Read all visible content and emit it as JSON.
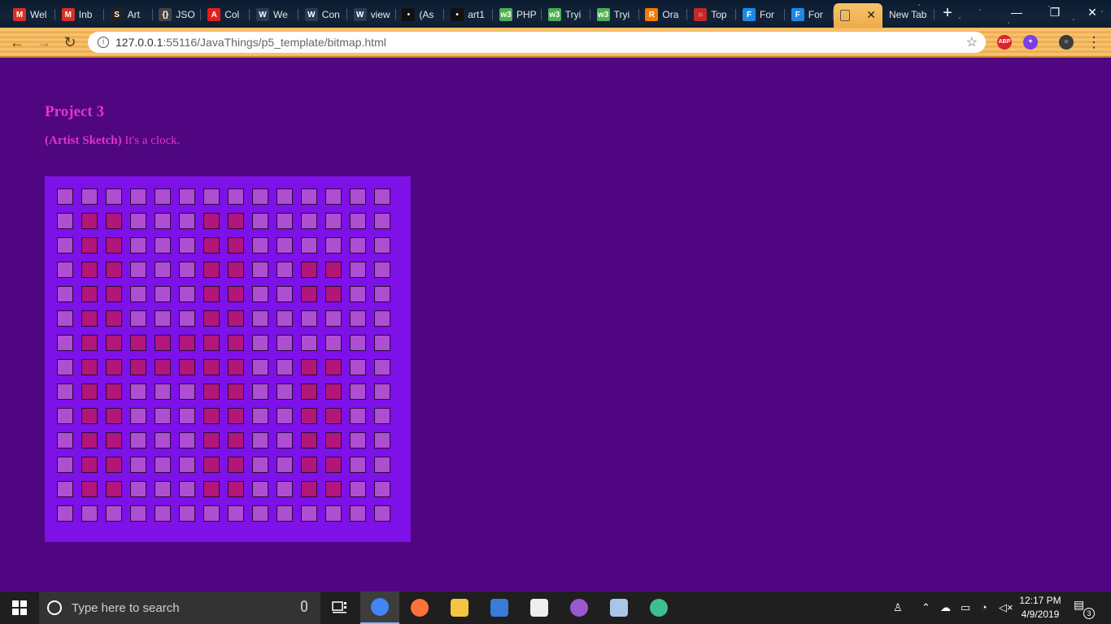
{
  "browser": {
    "tabs": [
      {
        "title": "Wel",
        "icon": "gmail-icon",
        "color": "#d93025",
        "glyph": "M"
      },
      {
        "title": "Inb",
        "icon": "gmail-icon",
        "color": "#d93025",
        "glyph": "M"
      },
      {
        "title": "Art",
        "icon": "s-icon",
        "color": "#222222",
        "glyph": "S"
      },
      {
        "title": "JSO",
        "icon": "braces-icon",
        "color": "#444444",
        "glyph": "{}"
      },
      {
        "title": "Col",
        "icon": "adobe-icon",
        "color": "#e0211b",
        "glyph": "A"
      },
      {
        "title": "We",
        "icon": "wix-icon",
        "color": "#2b3a55",
        "glyph": "W"
      },
      {
        "title": "Con",
        "icon": "wix-icon",
        "color": "#2b3a55",
        "glyph": "W"
      },
      {
        "title": "view",
        "icon": "wix-icon",
        "color": "#2b3a55",
        "glyph": "W"
      },
      {
        "title": "(As",
        "icon": "face-icon",
        "color": "#111111",
        "glyph": "•"
      },
      {
        "title": "art1",
        "icon": "face-icon",
        "color": "#111111",
        "glyph": "•"
      },
      {
        "title": "PHP",
        "icon": "w3-icon",
        "color": "#4caf50",
        "glyph": "w3"
      },
      {
        "title": "Tryi",
        "icon": "w3-icon",
        "color": "#4caf50",
        "glyph": "w3"
      },
      {
        "title": "Tryi",
        "icon": "w3-icon",
        "color": "#4caf50",
        "glyph": "w3"
      },
      {
        "title": "Ora",
        "icon": "r-icon",
        "color": "#f57c00",
        "glyph": "R"
      },
      {
        "title": "Top",
        "icon": "spinner-icon",
        "color": "#c62828",
        "glyph": "○"
      },
      {
        "title": "For",
        "icon": "form-icon",
        "color": "#1e88e5",
        "glyph": "F"
      },
      {
        "title": "For",
        "icon": "form-icon",
        "color": "#1e88e5",
        "glyph": "F"
      }
    ],
    "active_tab": {
      "title": "",
      "icon": "page-icon",
      "close_glyph": "✕"
    },
    "new_tab": {
      "title": "New Tab"
    },
    "new_tab_button": "+",
    "window_controls": {
      "minimize": "—",
      "restore": "❐",
      "close": "✕"
    },
    "nav": {
      "back": "←",
      "forward": "→",
      "reload": "↻"
    },
    "address": {
      "host": "127.0.0.1",
      "rest": ":55116/JavaThings/p5_template/bitmap.html",
      "info_glyph": "i",
      "star_glyph": "☆"
    },
    "extensions": [
      {
        "name": "abp-icon",
        "label": "ABP",
        "color": "#d8262c"
      },
      {
        "name": "color-picker-icon",
        "label": "✦",
        "color": "#7b3fe4"
      },
      {
        "name": "profile-avatar-icon",
        "label": "☺",
        "color": "#3b3b3b"
      }
    ],
    "menu_glyph": "⋮"
  },
  "page": {
    "title": "Project 3",
    "subtitle_bold": "(Artist Sketch)",
    "subtitle_rest": " It's a clock.",
    "canvas": {
      "rows": 14,
      "cols": 14,
      "background": "#7e10e8",
      "on_color": "#b2167a",
      "off_color": "#ae4fd2",
      "grid": [
        "00000000000000",
        "01100011000000",
        "01100011000000",
        "01100011001100",
        "01100011001100",
        "01100011000000",
        "01111111000000",
        "01111111001100",
        "01100011001100",
        "01100011001100",
        "01100011001100",
        "01100011001100",
        "01100011001100",
        "00000000000000"
      ]
    }
  },
  "taskbar": {
    "search_placeholder": "Type here to search",
    "apps": [
      {
        "name": "chrome-icon",
        "color": "#4285f4",
        "active": true
      },
      {
        "name": "firefox-icon",
        "color": "#ff7139",
        "active": false
      },
      {
        "name": "file-explorer-icon",
        "color": "#f4c542",
        "active": false
      },
      {
        "name": "store-icon",
        "color": "#3a7bd5",
        "active": false
      },
      {
        "name": "mail-icon",
        "color": "#eeeeee",
        "active": false
      },
      {
        "name": "github-desktop-icon",
        "color": "#9b59d0",
        "active": false
      },
      {
        "name": "photos-icon",
        "color": "#a9c6e8",
        "active": false
      },
      {
        "name": "atom-icon",
        "color": "#3fbf8f",
        "active": false
      }
    ],
    "time": "12:17 PM",
    "date": "4/9/2019",
    "notifications": "3"
  }
}
